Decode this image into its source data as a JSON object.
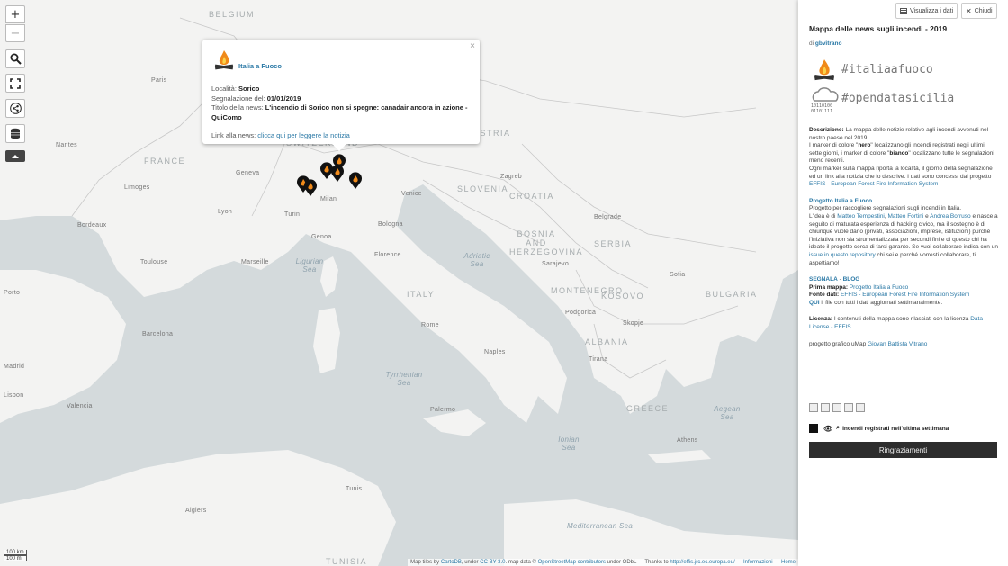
{
  "map": {
    "controls": {
      "zoom_in": "+",
      "zoom_out": "−",
      "icons": [
        "search-icon",
        "fullscreen-icon",
        "share-icon",
        "layers-icon",
        "collapse-icon"
      ]
    },
    "labels": {
      "countries": [
        "BELGIUM",
        "FRANCE",
        "SWITZERLAND",
        "ITALY",
        "SLOVENIA",
        "CROATIA",
        "BOSNIA AND HERZEGOVINA",
        "SERBIA",
        "MONTENEGRO",
        "KOSOVO",
        "BULGARIA",
        "ALBANIA",
        "GREECE",
        "TUNISIA",
        "AUSTRIA"
      ],
      "seas": [
        "Ligurian Sea",
        "Adriatic Sea",
        "Tyrrhenian Sea",
        "Ionian Sea",
        "Aegean Sea",
        "Mediterranean Sea"
      ],
      "cities": [
        "Paris",
        "Geneva",
        "Turin",
        "Milan",
        "Genoa",
        "Lyon",
        "Marseille",
        "Toulouse",
        "Bordeaux",
        "Limoges",
        "Nantes",
        "Rome",
        "Naples",
        "Venice",
        "Bologna",
        "Florence",
        "Zagreb",
        "Sarajevo",
        "Belgrade",
        "Podgorica",
        "Skopje",
        "Sofia",
        "Tirana",
        "Athens",
        "Palermo",
        "Madrid",
        "Barcelona",
        "Algiers",
        "Tunis",
        "Valencia",
        "Porto",
        "Lisbon"
      ]
    },
    "popup": {
      "brand": "Italia a Fuoco",
      "close": "×",
      "localita_label": "Località: ",
      "localita": "Sorico",
      "segnalazione_label": "Segnalazione del: ",
      "segnalazione": "01/01/2019",
      "titolo_label": "Titolo della news: ",
      "titolo": "L'incendio di Sorico non si spegne: canadair ancora in azione - QuiComo",
      "link_label": "Link alla news: ",
      "link_text": "clicca qui per leggere la notizia"
    },
    "scale": [
      "100 km",
      "100 mi"
    ],
    "attribution": {
      "text1": "Map tiles by ",
      "cartodb": "CartoDB",
      "text2": ", under ",
      "cc": "CC BY 3.0",
      "text3": ". map data © ",
      "osm": "OpenStreetMap contributors",
      "text4": " under ODbL — Thanks to ",
      "effis": "http://effis.jrc.ec.europa.eu/",
      "text5": " — ",
      "info": "Informazioni",
      "text6": " — ",
      "home": "Home"
    }
  },
  "panel": {
    "btn_view_data": "Visualizza i dati",
    "btn_close": "Chiudi",
    "title": "Mappa delle news sugli incendi - 2019",
    "by_prefix": "di ",
    "by_author": "gbvitrano",
    "hashtag1": "#italiaafuoco",
    "hashtag2": "#opendatasicilia",
    "desc_label": "Descrizione:",
    "desc_1": " La mappa delle notizie relative agli incendi avvenuti nel nostro paese nel 2019.",
    "desc_2a": "I marker di colore \"",
    "desc_nero": "nero",
    "desc_2b": "\" localizzano gli incendi registrati negli ultimi sette giorni, i marker di colore \"",
    "desc_bianco": "bianco",
    "desc_2c": "\" localizzano tutte le segnalazioni meno recenti.",
    "desc_3": "Ogni marker sulla mappa riporta la località, il giorno della segnalazione ed un link alla notizia che lo descrive. I dati sono concessi dal progetto ",
    "desc_effis": "EFFIS - European Forest Fire Information System",
    "project_title": "Progetto Italia a Fuoco",
    "project_1": "Progetto per raccogliere segnalazioni sugli incendi in Italia.",
    "project_2a": "L'idea è di ",
    "project_p1": "Matteo Tempestini",
    "project_p2": "Matteo Fortini",
    "project_and": " e ",
    "project_p3": "Andrea Borruso",
    "project_2b": " e nasce a seguito di maturata esperienza di hacking civico, ma il sostegno è di chiunque vuole darlo (privati, associazioni, imprese, istituzioni) purché l'iniziativa non sia strumentalizzata per secondi fini e di questo chi ha ideato il progetto cerca di farsi garante. Se vuoi collaborare indica con un ",
    "project_issue": "issue in questo repository",
    "project_2c": " chi sei e perché vorresti collaborare, ti aspettiamo!",
    "segnala": "SEGNALA",
    "sep": " - ",
    "blog": "BLOG",
    "prima_label": "Prima mappa:",
    "prima_val": "Progetto Italia a Fuoco",
    "fonte_label": "Fonte dati:",
    "fonte_val": "EFFIS - European Forest Fire Information System",
    "qui": "QUI",
    "qui_text": " il file con tutti i dati aggiornati settimanalmente.",
    "licenza_label": "Licenza:",
    "licenza_text": " I contenuti della mappa sono rilasciati con la licenza ",
    "licenza_link": "Data License - EFFIS",
    "grafico_text": "progetto grafico uMap ",
    "grafico_author": "Giovan Battista Vitrano",
    "layer_label": "Incendi registrati nell'ultima settimana",
    "thanks_button": "Ringraziamenti"
  }
}
